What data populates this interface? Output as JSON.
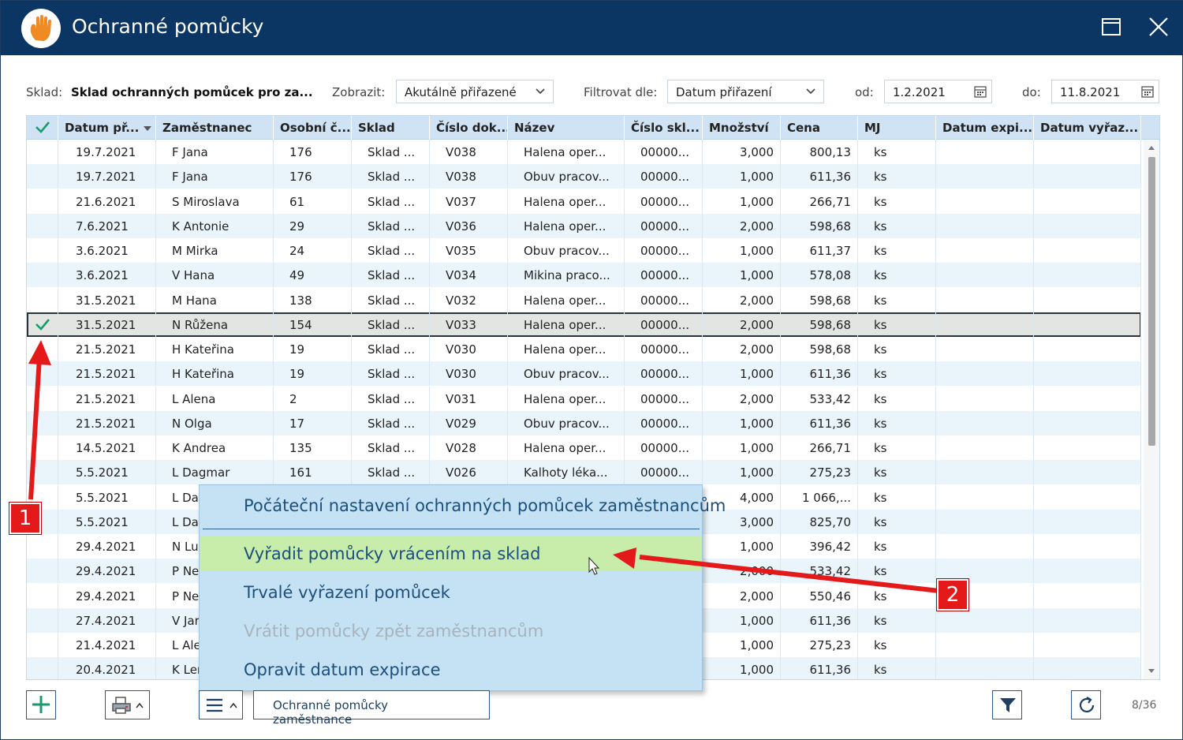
{
  "window": {
    "title": "Ochranné pomůcky",
    "accent_color": "#0b3563",
    "icon": "hand-icon"
  },
  "filters": {
    "sklad_label": "Sklad:",
    "sklad_value": "Sklad ochranných pomůcek pro za...",
    "zobrazit_label": "Zobrazit:",
    "zobrazit_value": "Akutálně přiřazené",
    "filtrovat_label": "Filtrovat dle:",
    "filtrovat_value": "Datum přiřazení",
    "od_label": "od:",
    "od_value": "1.2.2021",
    "do_label": "do:",
    "do_value": "11.8.2021"
  },
  "grid": {
    "columns": [
      "Datum př...",
      "Zaměstnanec",
      "Osobní č...",
      "Sklad",
      "Číslo dok...",
      "Název",
      "Číslo skl...",
      "Množství",
      "Cena",
      "MJ",
      "Datum expi...",
      "Datum vyřaz..."
    ],
    "rows": [
      {
        "date": "19.7.2021",
        "emp": "F Jana",
        "osc": "176",
        "sklad": "Sklad ...",
        "doc": "V038",
        "name": "Halena oper...",
        "skl": "00000...",
        "qty": "3,000",
        "price": "800,13",
        "mj": "ks"
      },
      {
        "date": "19.7.2021",
        "emp": "F Jana",
        "osc": "176",
        "sklad": "Sklad ...",
        "doc": "V038",
        "name": "Obuv pracov...",
        "skl": "00000...",
        "qty": "1,000",
        "price": "611,36",
        "mj": "ks"
      },
      {
        "date": "21.6.2021",
        "emp": "S Miroslava",
        "osc": "61",
        "sklad": "Sklad ...",
        "doc": "V037",
        "name": "Halena oper...",
        "skl": "00000...",
        "qty": "1,000",
        "price": "266,71",
        "mj": "ks"
      },
      {
        "date": "7.6.2021",
        "emp": "K Antonie",
        "osc": "29",
        "sklad": "Sklad ...",
        "doc": "V036",
        "name": "Halena oper...",
        "skl": "00000...",
        "qty": "2,000",
        "price": "598,68",
        "mj": "ks"
      },
      {
        "date": "3.6.2021",
        "emp": "M Mirka",
        "osc": "24",
        "sklad": "Sklad ...",
        "doc": "V035",
        "name": "Obuv pracov...",
        "skl": "00000...",
        "qty": "1,000",
        "price": "611,37",
        "mj": "ks"
      },
      {
        "date": "3.6.2021",
        "emp": "V Hana",
        "osc": "49",
        "sklad": "Sklad ...",
        "doc": "V034",
        "name": "Mikina praco...",
        "skl": "00000...",
        "qty": "1,000",
        "price": "578,08",
        "mj": "ks"
      },
      {
        "date": "31.5.2021",
        "emp": "M Hana",
        "osc": "138",
        "sklad": "Sklad ...",
        "doc": "V032",
        "name": "Halena oper...",
        "skl": "00000...",
        "qty": "2,000",
        "price": "598,68",
        "mj": "ks"
      },
      {
        "date": "31.5.2021",
        "emp": "N Růžena",
        "osc": "154",
        "sklad": "Sklad ...",
        "doc": "V033",
        "name": "Halena oper...",
        "skl": "00000...",
        "qty": "2,000",
        "price": "598,68",
        "mj": "ks"
      },
      {
        "date": "21.5.2021",
        "emp": "H Kateřina",
        "osc": "19",
        "sklad": "Sklad ...",
        "doc": "V030",
        "name": "Halena oper...",
        "skl": "00000...",
        "qty": "2,000",
        "price": "598,68",
        "mj": "ks"
      },
      {
        "date": "21.5.2021",
        "emp": "H Kateřina",
        "osc": "19",
        "sklad": "Sklad ...",
        "doc": "V030",
        "name": "Obuv pracov...",
        "skl": "00000...",
        "qty": "1,000",
        "price": "611,36",
        "mj": "ks"
      },
      {
        "date": "21.5.2021",
        "emp": "L Alena",
        "osc": "2",
        "sklad": "Sklad ...",
        "doc": "V031",
        "name": "Halena oper...",
        "skl": "00000...",
        "qty": "2,000",
        "price": "533,42",
        "mj": "ks"
      },
      {
        "date": "21.5.2021",
        "emp": "N Olga",
        "osc": "17",
        "sklad": "Sklad ...",
        "doc": "V029",
        "name": "Obuv pracov...",
        "skl": "00000...",
        "qty": "1,000",
        "price": "611,36",
        "mj": "ks"
      },
      {
        "date": "14.5.2021",
        "emp": "K Andrea",
        "osc": "135",
        "sklad": "Sklad ...",
        "doc": "V028",
        "name": "Halena oper...",
        "skl": "00000...",
        "qty": "1,000",
        "price": "266,71",
        "mj": "ks"
      },
      {
        "date": "5.5.2021",
        "emp": "L Dagmar",
        "osc": "161",
        "sklad": "Sklad ...",
        "doc": "V026",
        "name": "Kalhoty léka...",
        "skl": "00000...",
        "qty": "1,000",
        "price": "275,23",
        "mj": "ks"
      },
      {
        "date": "5.5.2021",
        "emp": "L Da",
        "osc": "",
        "sklad": "",
        "doc": "",
        "name": "",
        "skl": "",
        "qty": "4,000",
        "price": "1 066,...",
        "mj": "ks"
      },
      {
        "date": "5.5.2021",
        "emp": "L Da",
        "osc": "",
        "sklad": "",
        "doc": "",
        "name": "",
        "skl": "",
        "qty": "3,000",
        "price": "825,70",
        "mj": "ks"
      },
      {
        "date": "29.4.2021",
        "emp": "N Lu",
        "osc": "",
        "sklad": "",
        "doc": "",
        "name": "",
        "skl": "",
        "qty": "1,000",
        "price": "396,42",
        "mj": "ks"
      },
      {
        "date": "29.4.2021",
        "emp": "P Ne",
        "osc": "",
        "sklad": "",
        "doc": "",
        "name": "",
        "skl": "",
        "qty": "2,000",
        "price": "533,42",
        "mj": "ks"
      },
      {
        "date": "29.4.2021",
        "emp": "P Ne",
        "osc": "",
        "sklad": "",
        "doc": "",
        "name": "",
        "skl": "",
        "qty": "2,000",
        "price": "550,46",
        "mj": "ks"
      },
      {
        "date": "27.4.2021",
        "emp": "V Jar",
        "osc": "",
        "sklad": "",
        "doc": "",
        "name": "",
        "skl": "",
        "qty": "1,000",
        "price": "611,36",
        "mj": "ks"
      },
      {
        "date": "21.4.2021",
        "emp": "L Ale",
        "osc": "",
        "sklad": "",
        "doc": "",
        "name": "",
        "skl": "",
        "qty": "1,000",
        "price": "275,23",
        "mj": "ks"
      },
      {
        "date": "20.4.2021",
        "emp": "K Len",
        "osc": "",
        "sklad": "",
        "doc": "",
        "name": "",
        "skl": "",
        "qty": "1,000",
        "price": "611,36",
        "mj": "ks"
      }
    ]
  },
  "context_menu": {
    "items": [
      "Počáteční nastavení ochranných pomůcek zaměstnancům",
      "Vyřadit pomůcky vrácením na sklad",
      "Trvalé vyřazení pomůcek",
      "Vrátit pomůcky zpět zaměstnancům",
      "Opravit datum expirace"
    ]
  },
  "bottom": {
    "employee_protective_button": "Ochranné pomůcky zaměstnance",
    "pager": "8/36"
  },
  "annotations": {
    "badge_1": "1",
    "badge_2": "2",
    "color": "#e41a1a"
  }
}
